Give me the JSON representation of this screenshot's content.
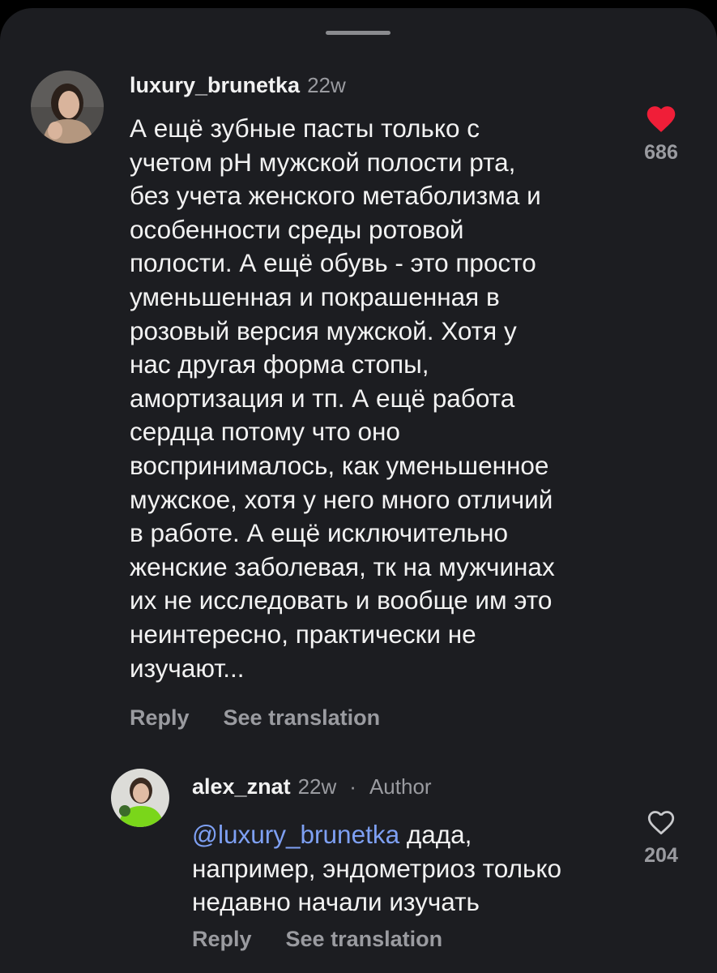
{
  "colors": {
    "background": "#1c1d21",
    "text": "#f2f2f2",
    "muted": "#9a9ba0",
    "mention": "#7ea0f3",
    "like_active": "#f01e38"
  },
  "comments": [
    {
      "username": "luxury_brunetka",
      "time": "22w",
      "lines": [
        "А ещё зубные пасты только с",
        "учетом pH мужской полости рта,",
        "без учета женского метаболизма и",
        "особенности среды ротовой",
        "полости. А ещё обувь - это просто",
        "уменьшенная и покрашенная в",
        "розовый версия мужской. Хотя у",
        "нас другая форма стопы,",
        "амортизация и тп. А ещё работа",
        "сердца потому что оно",
        "воспринималось, как уменьшенное",
        "мужское, хотя у него много отличий",
        "в работе. А ещё исключительно",
        "женские заболевая, тк на мужчинах",
        "их не исследовать и вообще им это",
        "неинтересно, практически не",
        "изучают..."
      ],
      "like_icon": "heart-filled-icon",
      "like_count": "686",
      "reply_label": "Reply",
      "translate_label": "See translation"
    },
    {
      "username": "alex_znat",
      "time": "22w",
      "separator": "·",
      "badge": "Author",
      "mention": "@luxury_brunetka",
      "lines": [
        " дада,",
        "например, эндометриоз только",
        "недавно начали изучать"
      ],
      "like_icon": "heart-outline-icon",
      "like_count": "204",
      "reply_label": "Reply",
      "translate_label": "See translation"
    }
  ]
}
